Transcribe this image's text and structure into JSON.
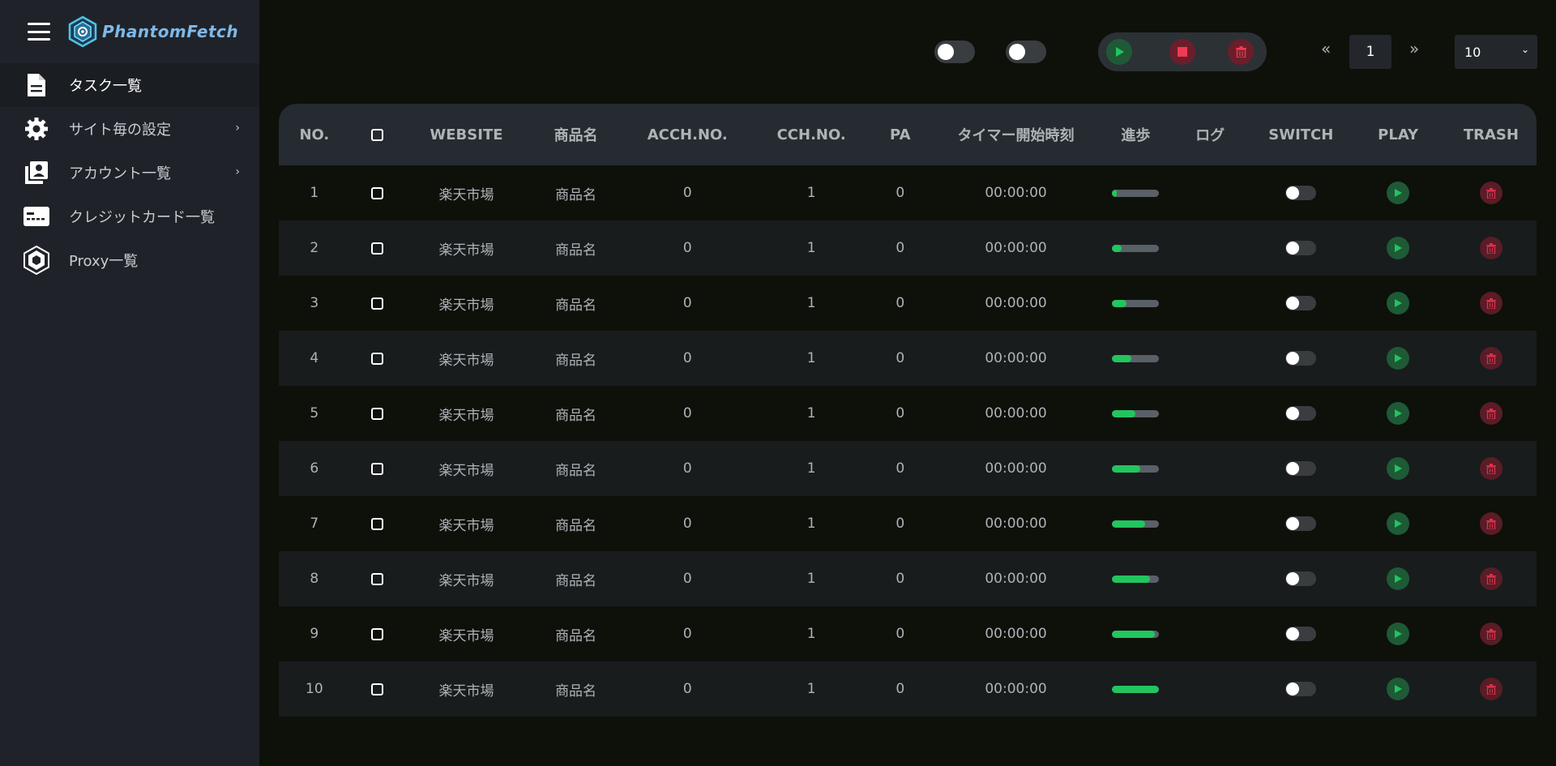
{
  "app": {
    "name": "PhantomFetch"
  },
  "sidebar": {
    "items": [
      {
        "label": "タスク一覧",
        "icon": "document-icon",
        "active": true,
        "chevron": false
      },
      {
        "label": "サイト毎の設定",
        "icon": "gear-icon",
        "active": false,
        "chevron": true
      },
      {
        "label": "アカウント一覧",
        "icon": "contacts-icon",
        "active": false,
        "chevron": true
      },
      {
        "label": "クレジットカード一覧",
        "icon": "credit-card-icon",
        "active": false,
        "chevron": false
      },
      {
        "label": "Proxy一覧",
        "icon": "proxy-hexagon-icon",
        "active": false,
        "chevron": false
      }
    ]
  },
  "toolbar": {
    "pager": {
      "prev": "«",
      "next": "»",
      "page": "1"
    },
    "per_page": "10"
  },
  "table": {
    "columns": [
      "NO.",
      "",
      "WEBSITE",
      "商品名",
      "ACCH.NO.",
      "CCH.NO.",
      "PA",
      "タイマー開始時刻",
      "進歩",
      "ログ",
      "SWITCH",
      "PLAY",
      "TRASH"
    ],
    "rows": [
      {
        "no": "1",
        "website": "楽天市場",
        "product": "商品名",
        "acch": "0",
        "cch": "1",
        "pa": "0",
        "timer": "00:00:00",
        "progress": 0.1
      },
      {
        "no": "2",
        "website": "楽天市場",
        "product": "商品名",
        "acch": "0",
        "cch": "1",
        "pa": "0",
        "timer": "00:00:00",
        "progress": 0.2
      },
      {
        "no": "3",
        "website": "楽天市場",
        "product": "商品名",
        "acch": "0",
        "cch": "1",
        "pa": "0",
        "timer": "00:00:00",
        "progress": 0.3
      },
      {
        "no": "4",
        "website": "楽天市場",
        "product": "商品名",
        "acch": "0",
        "cch": "1",
        "pa": "0",
        "timer": "00:00:00",
        "progress": 0.4
      },
      {
        "no": "5",
        "website": "楽天市場",
        "product": "商品名",
        "acch": "0",
        "cch": "1",
        "pa": "0",
        "timer": "00:00:00",
        "progress": 0.5
      },
      {
        "no": "6",
        "website": "楽天市場",
        "product": "商品名",
        "acch": "0",
        "cch": "1",
        "pa": "0",
        "timer": "00:00:00",
        "progress": 0.6
      },
      {
        "no": "7",
        "website": "楽天市場",
        "product": "商品名",
        "acch": "0",
        "cch": "1",
        "pa": "0",
        "timer": "00:00:00",
        "progress": 0.7
      },
      {
        "no": "8",
        "website": "楽天市場",
        "product": "商品名",
        "acch": "0",
        "cch": "1",
        "pa": "0",
        "timer": "00:00:00",
        "progress": 0.8
      },
      {
        "no": "9",
        "website": "楽天市場",
        "product": "商品名",
        "acch": "0",
        "cch": "1",
        "pa": "0",
        "timer": "00:00:00",
        "progress": 0.9
      },
      {
        "no": "10",
        "website": "楽天市場",
        "product": "商品名",
        "acch": "0",
        "cch": "1",
        "pa": "0",
        "timer": "00:00:00",
        "progress": 1.0
      }
    ]
  },
  "colors": {
    "sidebar": "#1f2329",
    "background": "#0e100a",
    "header": "#262b31",
    "progress": "#22c55e",
    "play": "#1e5a36",
    "trash": "#5a1c26",
    "brand": "#7fb8e8"
  }
}
